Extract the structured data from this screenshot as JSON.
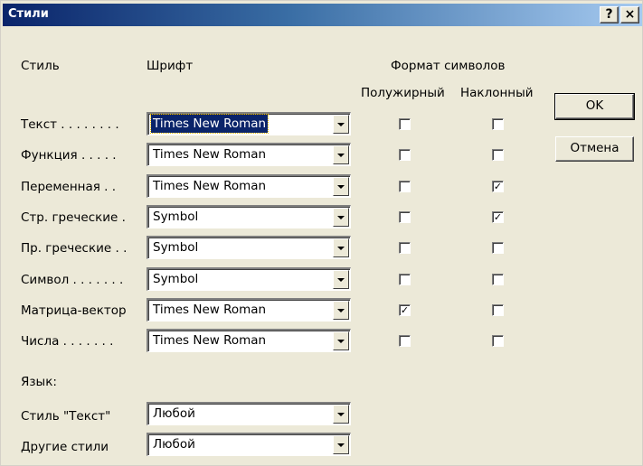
{
  "window": {
    "title": "Стили",
    "help_label": "?",
    "close_label": "×"
  },
  "headers": {
    "style": "Стиль",
    "font": "Шрифт",
    "format": "Формат символов",
    "bold": "Полужирный",
    "italic": "Наклонный"
  },
  "rows": [
    {
      "label": "Текст . . . . . . . .",
      "font": "Times New Roman",
      "bold": "",
      "italic": ""
    },
    {
      "label": "Функция  . . . . .",
      "font": "Times New Roman",
      "bold": "",
      "italic": ""
    },
    {
      "label": "Переменная . .",
      "font": "Times New Roman",
      "bold": "",
      "italic": "✓"
    },
    {
      "label": "Стр. греческие .",
      "font": "Symbol",
      "bold": "",
      "italic": "✓"
    },
    {
      "label": "Пр. греческие . .",
      "font": "Symbol",
      "bold": "",
      "italic": ""
    },
    {
      "label": "Символ . . . . . . .",
      "font": "Symbol",
      "bold": "",
      "italic": ""
    },
    {
      "label": "Матрица-вектор",
      "font": "Times New Roman",
      "bold": "✓",
      "italic": ""
    },
    {
      "label": "Числа . . . . . . .",
      "font": "Times New Roman",
      "bold": "",
      "italic": ""
    }
  ],
  "language": {
    "heading": "Язык:",
    "text_style_label": "Стиль \"Текст\"",
    "text_style_value": "Любой",
    "other_styles_label": "Другие стили",
    "other_styles_value": "Любой"
  },
  "buttons": {
    "ok": "OK",
    "cancel": "Отмена"
  }
}
